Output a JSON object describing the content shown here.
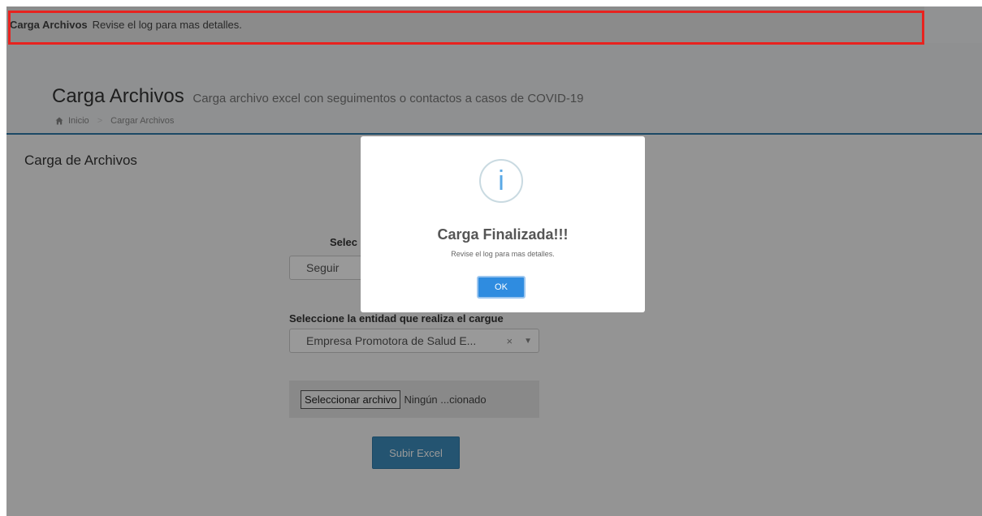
{
  "notification": {
    "title": "Carga Archivos",
    "message": "Revise el log para mas detalles."
  },
  "header": {
    "title": "Carga Archivos",
    "subtitle": "Carga archivo excel con seguimentos o contactos a casos de COVID-19",
    "breadcrumb": [
      "Inicio",
      "Cargar Archivos"
    ]
  },
  "content": {
    "section_title": "Carga de Archivos",
    "type_label": "Selec",
    "type_value": "Seguir",
    "entity_label": "Seleccione la entidad que realiza el cargue",
    "entity_value": "Empresa Promotora de Salud E...",
    "entity_clear": "×",
    "entity_arrow": "▼",
    "file_button": "Seleccionar archivo",
    "file_status": "Ningún ...cionado",
    "upload_button": "Subir Excel"
  },
  "modal": {
    "icon_glyph": "i",
    "title": "Carga Finalizada!!!",
    "text": "Revise el log para mas detalles.",
    "ok": "OK"
  },
  "colors": {
    "highlight": "#e8231f",
    "primary": "#3c8dbc",
    "ok_button": "#2f8ce0"
  }
}
